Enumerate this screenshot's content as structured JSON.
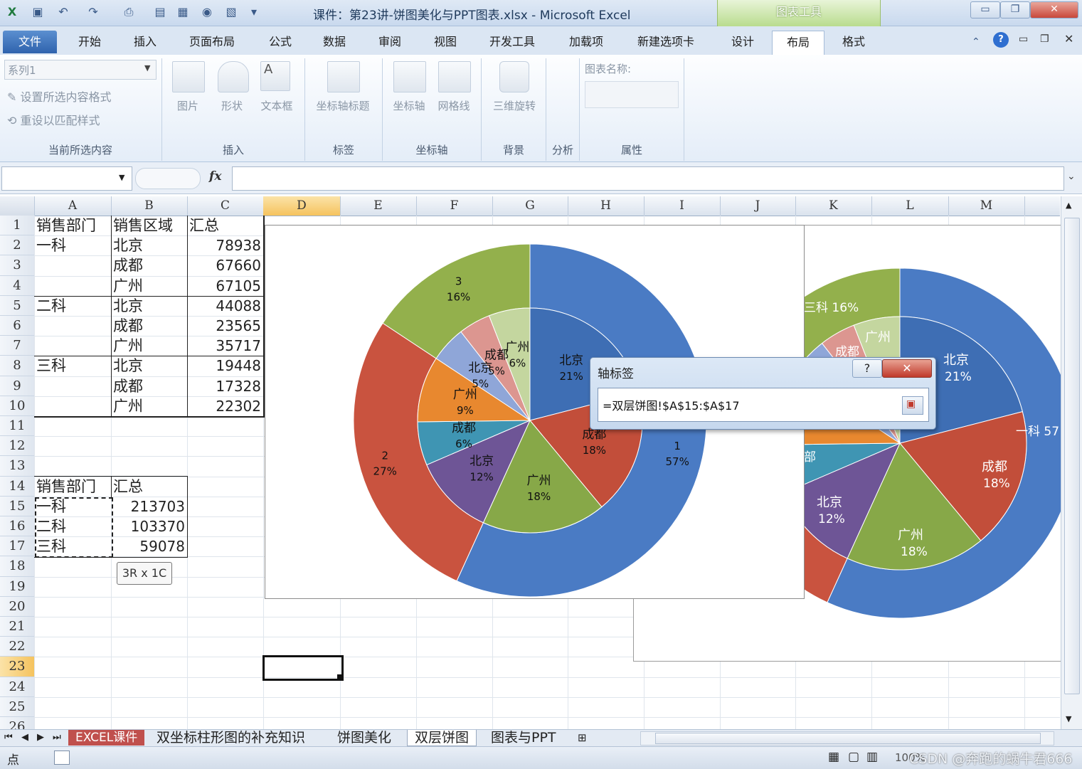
{
  "window": {
    "title": "课件：第23讲-饼图美化与PPT图表.xlsx - Microsoft Excel",
    "context_tab_group": "图表工具"
  },
  "tabs": [
    "文件",
    "开始",
    "插入",
    "页面布局",
    "公式",
    "数据",
    "审阅",
    "视图",
    "开发工具",
    "加载项",
    "新建选项卡",
    "设计",
    "布局",
    "格式"
  ],
  "ribbon": {
    "current_selection": {
      "dropdown_value": "系列1",
      "format_selection": "设置所选内容格式",
      "reset_style": "重设以匹配样式",
      "label": "当前所选内容"
    },
    "insert": {
      "picture": "图片",
      "shapes": "形状",
      "textbox": "文本框",
      "label": "插入"
    },
    "labels_group": {
      "axis_titles": "坐标轴标题",
      "label": "标签"
    },
    "axes_group": {
      "axes": "坐标轴",
      "gridlines": "网格线",
      "label": "坐标轴"
    },
    "background": {
      "rotation_3d": "三维旋转",
      "label": "背景"
    },
    "analysis": {
      "label": "分析"
    },
    "properties": {
      "chart_name_label": "图表名称:",
      "label": "属性"
    }
  },
  "formula_bar": {
    "fx": "fx",
    "name_box": "",
    "formula": ""
  },
  "columns": [
    "A",
    "B",
    "C",
    "D",
    "E",
    "F",
    "G",
    "H",
    "I",
    "J",
    "K",
    "L",
    "M"
  ],
  "rows": [
    "1",
    "2",
    "3",
    "4",
    "5",
    "6",
    "7",
    "8",
    "9",
    "10",
    "11",
    "12",
    "13",
    "14",
    "15",
    "16",
    "17",
    "18",
    "19",
    "20",
    "21",
    "22",
    "23",
    "24",
    "25",
    "26"
  ],
  "table1": {
    "headers": [
      "销售部门",
      "销售区域",
      "汇总"
    ],
    "rows": [
      [
        "一科",
        "北京",
        "78938"
      ],
      [
        "",
        "成都",
        "67660"
      ],
      [
        "",
        "广州",
        "67105"
      ],
      [
        "二科",
        "北京",
        "44088"
      ],
      [
        "",
        "成都",
        "23565"
      ],
      [
        "",
        "广州",
        "35717"
      ],
      [
        "三科",
        "北京",
        "19448"
      ],
      [
        "",
        "成都",
        "17328"
      ],
      [
        "",
        "广州",
        "22302"
      ]
    ]
  },
  "table2": {
    "headers": [
      "销售部门",
      "汇总"
    ],
    "rows": [
      [
        "一科",
        "213703"
      ],
      [
        "二科",
        "103370"
      ],
      [
        "三科",
        "59078"
      ]
    ]
  },
  "selection_tip": "3R x 1C",
  "chart_data": {
    "type": "pie",
    "outer": {
      "categories": [
        "1",
        "2",
        "3"
      ],
      "values": [
        213703,
        103370,
        59078
      ],
      "percent_labels": [
        "57%",
        "27%",
        "16%"
      ],
      "colors": [
        "#4a7bc4",
        "#c9533f",
        "#93b04c"
      ]
    },
    "inner": {
      "categories": [
        "北京",
        "成都",
        "广州",
        "北京",
        "成都",
        "广州",
        "北京",
        "成都",
        "广州"
      ],
      "values": [
        78938,
        67660,
        67105,
        44088,
        23565,
        35717,
        19448,
        17328,
        22302
      ],
      "percent_labels": [
        "21%",
        "18%",
        "18%",
        "12%",
        "6%",
        "9%",
        "5%",
        "5%",
        "6%"
      ],
      "colors": [
        "#3e6eb4",
        "#c24e3a",
        "#87a848",
        "#6e5596",
        "#3f95b3",
        "#e8882f",
        "#8fa6d8",
        "#dc9690",
        "#c4d69f"
      ]
    }
  },
  "chart2_labels": {
    "top_left": "三科 16%",
    "guangzhou": "广州",
    "chengdu_partial": "成都",
    "beijing": "北京",
    "beijing_pct": "21%",
    "yike": "一科 57",
    "chengdu": "成都",
    "chengdu_pct": "18%",
    "beijing2": "北京",
    "beijing2_pct": "12%",
    "guangzhou2": "广州",
    "guangzhou2_pct": "18%",
    "cut_left": "部"
  },
  "dialog": {
    "title": "轴标签",
    "help": "?",
    "close": "✕",
    "value": "=双层饼图!$A$15:$A$17"
  },
  "sheet_tabs": [
    "EXCEL课件",
    "双坐标柱形图的补充知识",
    "饼图美化",
    "双层饼图",
    "图表与PPT"
  ],
  "status": {
    "mode": "点",
    "zoom": "100%",
    "watermark": "CSDN @奔跑的蜗牛君666"
  }
}
